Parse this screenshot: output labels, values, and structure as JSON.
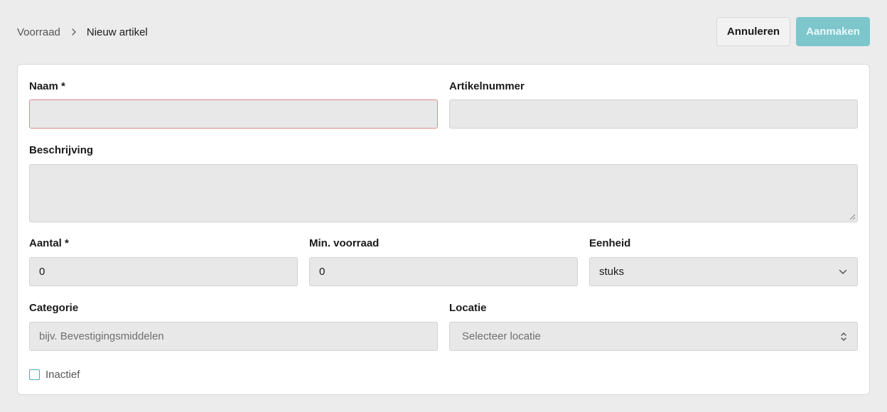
{
  "breadcrumb": {
    "root": "Voorraad",
    "current": "Nieuw artikel"
  },
  "actions": {
    "cancel_label": "Annuleren",
    "create_label": "Aanmaken"
  },
  "form": {
    "name": {
      "label": "Naam *",
      "value": ""
    },
    "article_number": {
      "label": "Artikelnummer",
      "value": ""
    },
    "description": {
      "label": "Beschrijving",
      "value": ""
    },
    "quantity": {
      "label": "Aantal *",
      "value": "0"
    },
    "min_stock": {
      "label": "Min. voorraad",
      "value": "0"
    },
    "unit": {
      "label": "Eenheid",
      "value": "stuks"
    },
    "category": {
      "label": "Categorie",
      "placeholder": "bijv. Bevestigingsmiddelen"
    },
    "location": {
      "label": "Locatie",
      "placeholder": "Selecteer locatie"
    },
    "inactive": {
      "label": "Inactief",
      "checked": false
    }
  },
  "icons": {
    "breadcrumb_separator": "chevron-right-icon",
    "unit_select": "chevron-down-icon",
    "location_select": "chevron-up-down-icon"
  },
  "colors": {
    "accent": "#7cc6cc",
    "error_border": "#e08a8a",
    "checkbox_border": "#4aaab3"
  }
}
